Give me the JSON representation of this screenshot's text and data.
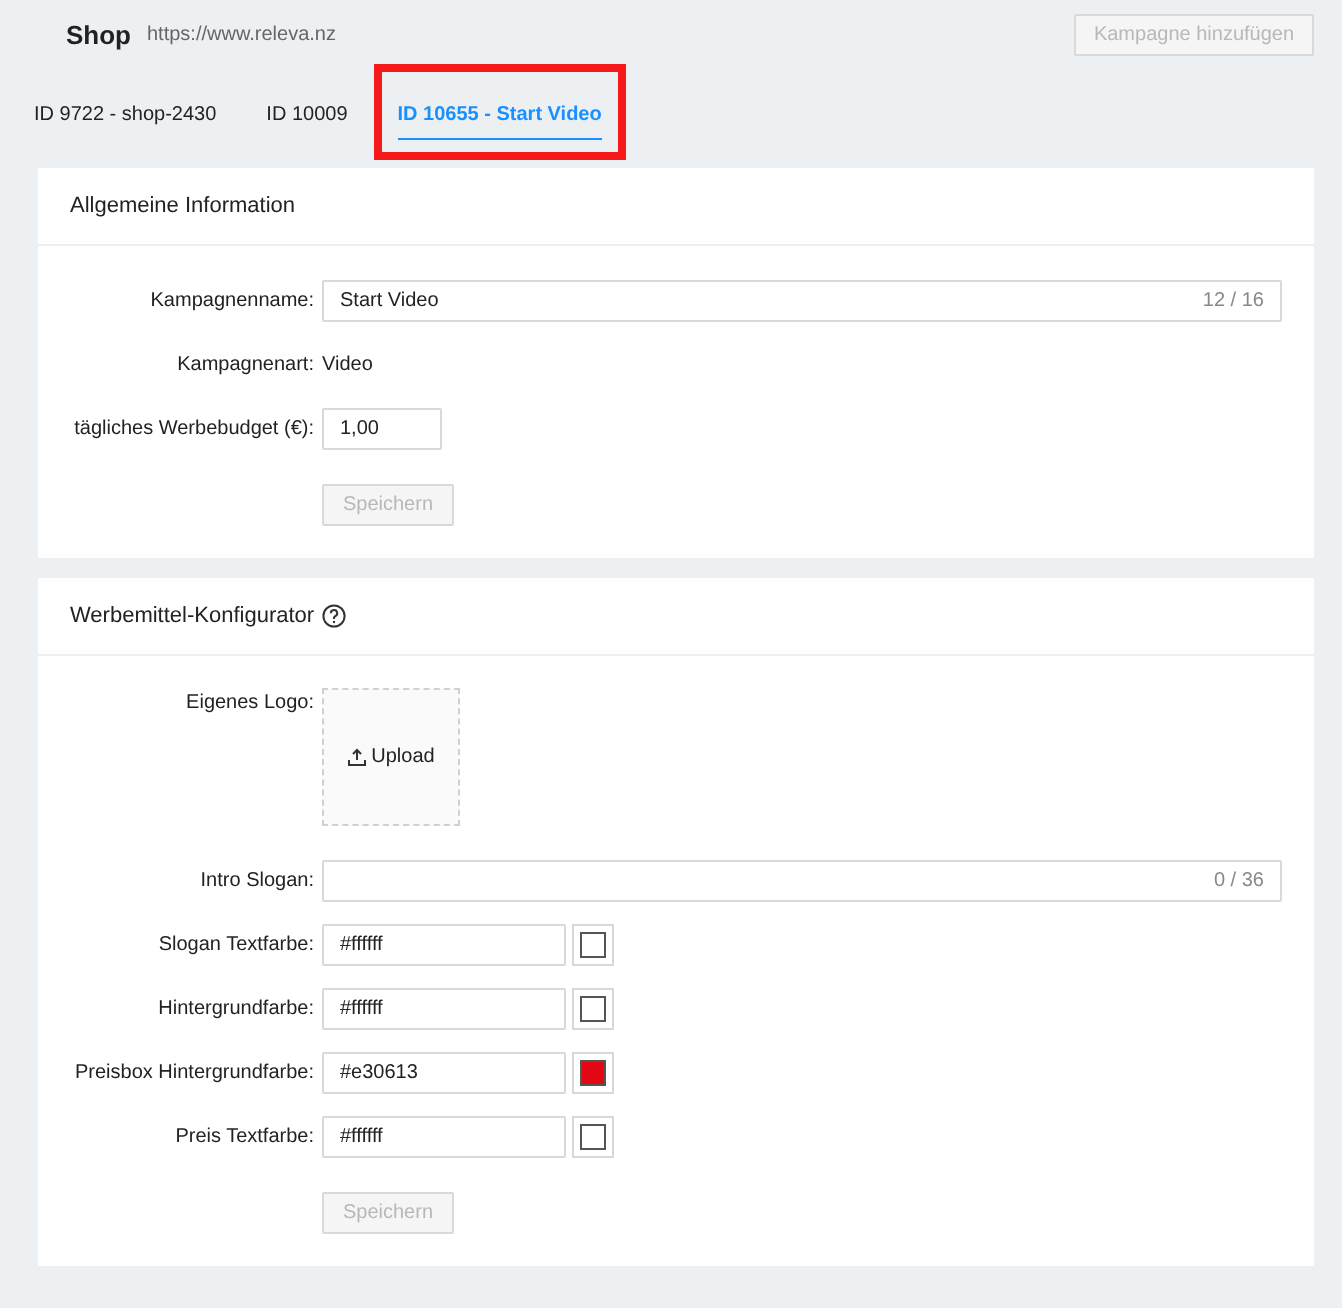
{
  "header": {
    "title": "Shop",
    "url": "https://www.releva.nz",
    "button": {
      "label": "Kampagne hinzufügen",
      "disabled": true
    }
  },
  "tabs": [
    {
      "label": "ID 9722 - shop-2430",
      "selected": false,
      "highlighted": false
    },
    {
      "label": "ID 10009",
      "selected": false,
      "highlighted": false
    },
    {
      "label": "ID 10655 - Start Video",
      "selected": true,
      "highlighted": true
    }
  ],
  "sections": [
    {
      "title": "Allgemeine Information",
      "help": false,
      "rows": [
        {
          "kind": "counter",
          "label": "Kampagnenname:",
          "value": "Start Video",
          "counter": "12 / 16"
        },
        {
          "kind": "static",
          "label": "Kampagnenart:",
          "value": "Video"
        },
        {
          "kind": "small",
          "label": "tägliches Werbebudget (€):",
          "value": "1,00"
        },
        {
          "kind": "button",
          "label": "Speichern",
          "disabled": true
        }
      ]
    },
    {
      "title": "Werbemittel-Konfigurator",
      "help": true,
      "rows": [
        {
          "kind": "upload",
          "label": "Eigenes Logo:",
          "button": "Upload"
        },
        {
          "kind": "counter",
          "label": "Intro Slogan:",
          "counter": "0 / 36"
        },
        {
          "kind": "color",
          "label": "Slogan Textfarbe:",
          "value": "#ffffff",
          "color": "#ffffff"
        },
        {
          "kind": "color",
          "label": "Hintergrundfarbe:",
          "value": "#ffffff",
          "color": "#ffffff"
        },
        {
          "kind": "color",
          "label": "Preisbox Hintergrundfarbe:",
          "value": "#e30613",
          "color": "#e30613"
        },
        {
          "kind": "color",
          "label": "Preis Textfarbe:",
          "value": "#ffffff",
          "color": "#ffffff"
        },
        {
          "kind": "button",
          "label": "Speichern",
          "disabled": true
        }
      ]
    }
  ]
}
